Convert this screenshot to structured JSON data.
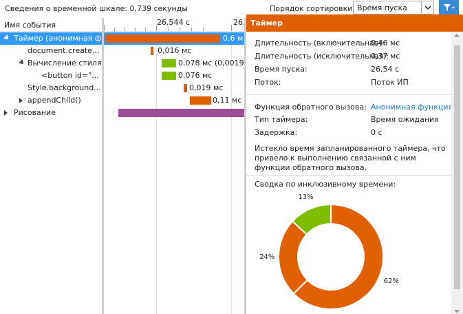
{
  "toolbar": {
    "summary": "Сведения о временной шкале: 0,739 секунды",
    "sort_label": "Порядок сортировки:",
    "sort_value": "Время пуска"
  },
  "tree": {
    "header": "Имя события",
    "rows": [
      {
        "label": "Таймер (анонимная ф...",
        "expander": "open",
        "selected": true
      },
      {
        "label": "document.create...",
        "expander": "none",
        "selected": false
      },
      {
        "label": "Вычисление стиля",
        "expander": "open",
        "selected": false
      },
      {
        "label": "<button id=\"...",
        "expander": "none",
        "selected": false
      },
      {
        "label": "Style.background...",
        "expander": "none",
        "selected": false
      },
      {
        "label": "appendChild()",
        "expander": "closed",
        "selected": false
      },
      {
        "label": "Рисование",
        "expander": "closed",
        "selected": false
      }
    ]
  },
  "timeline": {
    "ticks": [
      "26,544 с",
      "26."
    ],
    "bars": [
      {
        "label": "0,6 м",
        "color": "#e06000"
      },
      {
        "label": "0,016 мс",
        "color": "#e06000"
      },
      {
        "label": "0,078 мс (0,0019...",
        "color": "#7fbd00"
      },
      {
        "label": "0,076 мс",
        "color": "#7fbd00"
      },
      {
        "label": "0,019 мс",
        "color": "#e06000"
      },
      {
        "label": "0,11 мс",
        "color": "#e06000"
      },
      {
        "label": "",
        "color": "#9b4f96"
      }
    ]
  },
  "details": {
    "title": "Таймер",
    "props": [
      {
        "key": "Длительность (включительная):",
        "value": "0,46 мс"
      },
      {
        "key": "Длительность (исключительная):",
        "value": "0,37 мс"
      },
      {
        "key": "Время пуска:",
        "value": "26,54 с"
      },
      {
        "key": "Поток:",
        "value": "Поток ИП"
      }
    ],
    "props2": [
      {
        "key": "Функция обратного вызова:",
        "value": "Анонимная функция",
        "link": true
      },
      {
        "key": "Тип таймера:",
        "value": "Время ожидания",
        "link": false
      },
      {
        "key": "Задержка:",
        "value": "0 с",
        "link": false
      }
    ],
    "description": "Истекло время запланированного таймера, что привело к выполнению связанной с ним функции обратного вызова.",
    "summary_title": "Сводка по инклюзивному времени:"
  },
  "chart_data": {
    "type": "pie",
    "donut": true,
    "slices": [
      {
        "label": "62%",
        "value": 62,
        "color": "#e06000"
      },
      {
        "label": "24%",
        "value": 24,
        "color": "#e06000"
      },
      {
        "label": "13%",
        "value": 13,
        "color": "#7fbd00"
      }
    ]
  },
  "colors": {
    "accent": "#e06000",
    "selection": "#3399ff",
    "script": "#7fbd00",
    "paint": "#9b4f96",
    "link": "#1a73c9"
  }
}
